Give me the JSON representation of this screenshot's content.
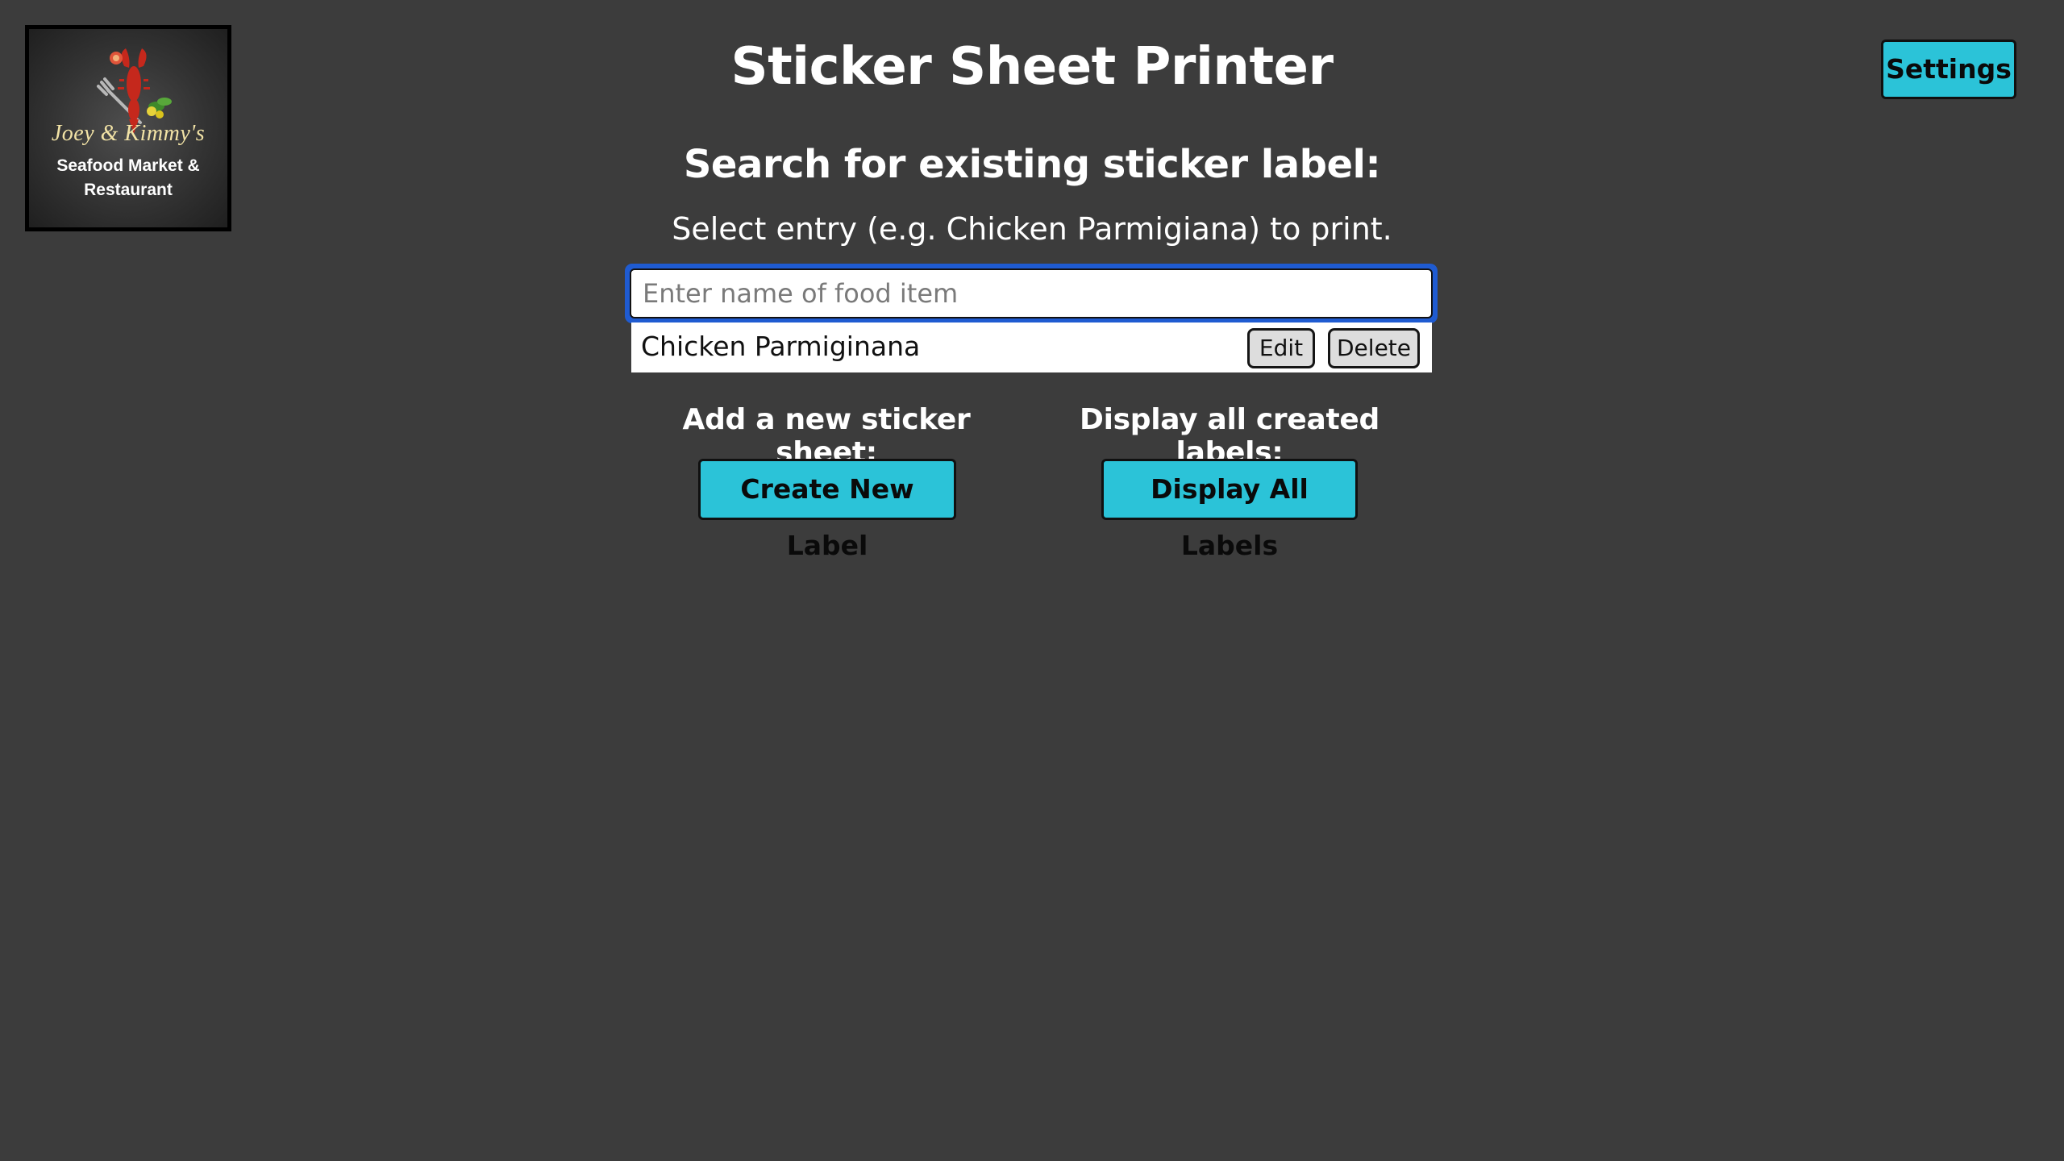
{
  "logo": {
    "name": "Joey & Kimmy's",
    "subtitle_line1": "Seafood Market &",
    "subtitle_line2": "Restaurant"
  },
  "header": {
    "title": "Sticker Sheet Printer",
    "settings_label": "Settings"
  },
  "search": {
    "heading": "Search for existing sticker label:",
    "description": "Select entry (e.g. Chicken Parmigiana) to print.",
    "placeholder": "Enter name of food item",
    "value": "",
    "results": [
      {
        "name": "Chicken Parmiginana",
        "edit_label": "Edit",
        "delete_label": "Delete"
      }
    ]
  },
  "actions": {
    "add_heading": "Add a new sticker sheet:",
    "create_label": "Create New Label",
    "display_heading": "Display all created labels:",
    "display_label": "Display All Labels"
  },
  "colors": {
    "background": "#3c3c3c",
    "accent_button": "#2bc3d8",
    "focus_ring": "#1f5bd1"
  }
}
